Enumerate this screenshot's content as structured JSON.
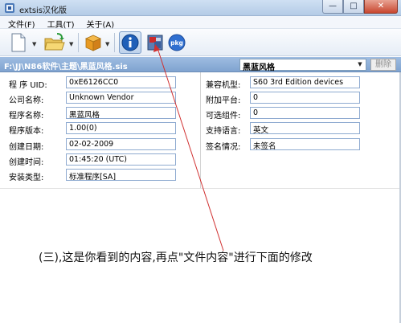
{
  "window": {
    "title": "extsis汉化版",
    "minimize": "—",
    "maximize": "□",
    "close": "✕"
  },
  "menu": [
    {
      "label": "文件(F)"
    },
    {
      "label": "工具(T)"
    },
    {
      "label": "关于(A)"
    }
  ],
  "toolbar": {
    "pkg_label": "pkg"
  },
  "pathbar": {
    "path": "F:\\JJ\\N86软件\\主题\\黑蓝风格.sis",
    "combo_value": "黑蓝风格",
    "delete_label": "删除"
  },
  "left_fields": [
    {
      "label": "程 序 UID:",
      "value": "0xE6126CC0"
    },
    {
      "label": "公司名称:",
      "value": "Unknown Vendor"
    },
    {
      "label": "程序名称:",
      "value": "黑蓝风格"
    },
    {
      "label": "程序版本:",
      "value": "1.00(0)"
    },
    {
      "label": "创建日期:",
      "value": "02-02-2009"
    },
    {
      "label": "创建时间:",
      "value": "01:45:20 (UTC)"
    },
    {
      "label": "安装类型:",
      "value": "标准程序[SA]"
    }
  ],
  "right_fields": [
    {
      "label": "兼容机型:",
      "value": "S60 3rd Edition devices"
    },
    {
      "label": "附加平台:",
      "value": "0"
    },
    {
      "label": "可选组件:",
      "value": "0"
    },
    {
      "label": "支持语言:",
      "value": "英文"
    },
    {
      "label": "签名情况:",
      "value": "未签名"
    }
  ],
  "annotation": "(三),这是你看到的内容,再点\"文件内容\"进行下面的修改",
  "colors": {
    "pathbar": "#8fb0d9",
    "arrow": "#d03030",
    "info_icon": "#1f5fb8"
  }
}
